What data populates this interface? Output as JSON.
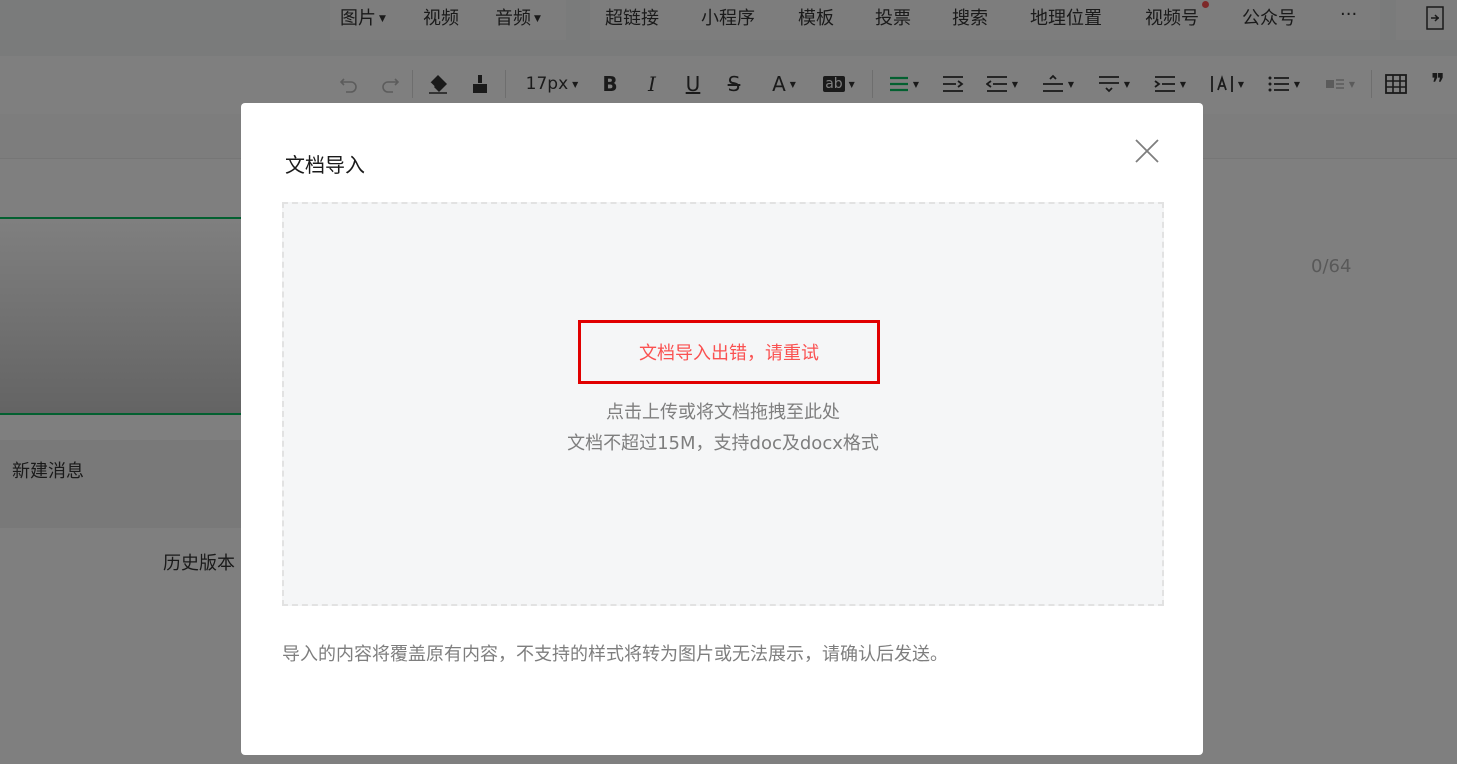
{
  "menu": {
    "group1": [
      {
        "label": "图片",
        "caret": true
      },
      {
        "label": "视频",
        "caret": false
      },
      {
        "label": "音频",
        "caret": true
      }
    ],
    "group2": [
      {
        "label": "超链接"
      },
      {
        "label": "小程序"
      },
      {
        "label": "模板"
      },
      {
        "label": "投票"
      },
      {
        "label": "搜索"
      },
      {
        "label": "地理位置"
      },
      {
        "label": "视频号",
        "badge_dot": true
      },
      {
        "label": "公众号"
      },
      {
        "label": "···"
      }
    ]
  },
  "toolbar": {
    "font_size": "17px",
    "bold": "B",
    "italic": "I",
    "underline": "U",
    "strike": "S",
    "font_color": "A",
    "highlight": "ab",
    "quote": "❞",
    "accent_color": "#07c160",
    "icons": [
      "undo-icon",
      "redo-icon",
      "eraser-icon",
      "format-brush-icon",
      "align-justify-icon",
      "indent-icon",
      "outdent-icon",
      "line-height-icon",
      "paragraph-spacing-icon",
      "list-indent-icon",
      "letter-spacing-icon",
      "bullet-list-icon",
      "float-icon",
      "table-icon",
      "quote-icon"
    ]
  },
  "editor": {
    "new_message": "新建消息",
    "history": "历史版本",
    "title_count": "0/64"
  },
  "dialog": {
    "title": "文档导入",
    "error": "文档导入出错，请重试",
    "hint_line1": "点击上传或将文档拖拽至此处",
    "hint_line2": "文档不超过15M，支持doc及docx格式",
    "notice": "导入的内容将覆盖原有内容，不支持的样式将转为图片或无法展示，请确认后发送。",
    "error_color": "#fa5151",
    "highlight_box_color": "#e10000"
  }
}
